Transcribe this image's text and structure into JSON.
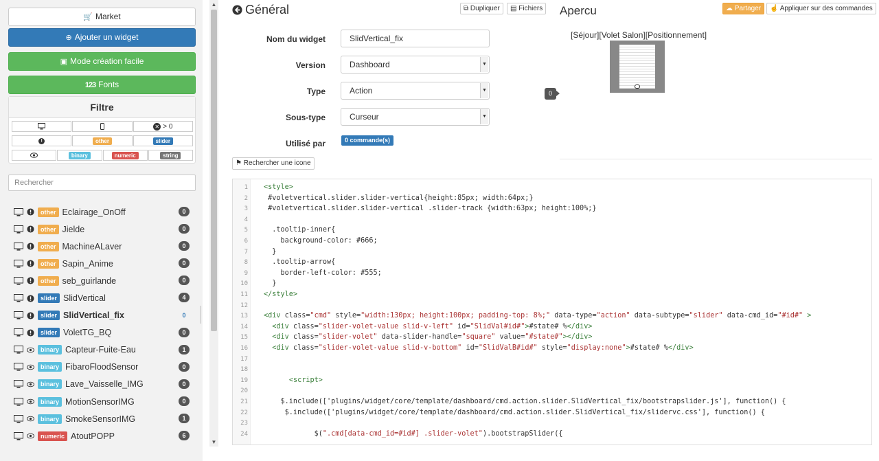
{
  "sidebar": {
    "market_label": "Market",
    "add_widget_label": "Ajouter un widget",
    "easy_mode_label": "Mode création facile",
    "fonts_label": "Fonts",
    "fonts_icon_text": "123",
    "filter_title": "Filtre",
    "filter_count_label": "> 0",
    "search_placeholder": "Rechercher",
    "filter_types": {
      "other": "other",
      "slider": "slider",
      "binary": "binary",
      "numeric": "numeric",
      "string": "string"
    },
    "widgets": [
      {
        "type": "other",
        "name": "Eclairage_OnOff",
        "count": "0",
        "eye": false
      },
      {
        "type": "other",
        "name": "Jielde",
        "count": "0",
        "eye": false
      },
      {
        "type": "other",
        "name": "MachineALaver",
        "count": "0",
        "eye": false
      },
      {
        "type": "other",
        "name": "Sapin_Anime",
        "count": "0",
        "eye": false
      },
      {
        "type": "other",
        "name": "seb_guirlande",
        "count": "0",
        "eye": false
      },
      {
        "type": "slider",
        "name": "SlidVertical",
        "count": "4",
        "eye": false
      },
      {
        "type": "slider",
        "name": "SlidVertical_fix",
        "count": "0",
        "eye": false,
        "active": true
      },
      {
        "type": "slider",
        "name": "VoletTG_BQ",
        "count": "0",
        "eye": false
      },
      {
        "type": "binary",
        "name": "Capteur-Fuite-Eau",
        "count": "1",
        "eye": true
      },
      {
        "type": "binary",
        "name": "FibaroFloodSensor",
        "count": "0",
        "eye": true
      },
      {
        "type": "binary",
        "name": "Lave_Vaisselle_IMG",
        "count": "0",
        "eye": true
      },
      {
        "type": "binary",
        "name": "MotionSensorIMG",
        "count": "0",
        "eye": true
      },
      {
        "type": "binary",
        "name": "SmokeSensorIMG",
        "count": "1",
        "eye": true
      },
      {
        "type": "numeric",
        "name": "AtoutPOPP",
        "count": "6",
        "eye": true
      }
    ]
  },
  "colors": {
    "other": "#f0ad4e",
    "slider": "#337ab7",
    "binary": "#5bc0de",
    "numeric": "#d9534f",
    "string": "#777777"
  },
  "general": {
    "title": "Général",
    "duplicate_label": "Dupliquer",
    "files_label": "Fichiers",
    "name_label": "Nom du widget",
    "name_value": "SlidVertical_fix",
    "version_label": "Version",
    "version_value": "Dashboard",
    "type_label": "Type",
    "type_value": "Action",
    "subtype_label": "Sous-type",
    "subtype_value": "Curseur",
    "used_label": "Utilisé par",
    "used_value": "0 commande(s)",
    "search_icon_label": "Rechercher une icone"
  },
  "preview": {
    "title": "Apercu",
    "share_label": "Partager",
    "apply_label": "Appliquer sur des commandes",
    "widget_label": "[Séjour][Volet Salon][Positionnement]",
    "tooltip_value": "0"
  },
  "code": [
    {
      "n": "1",
      "t": "<style>"
    },
    {
      "n": "2",
      "t": " #voletvertical.slider.slider-vertical{height:85px; width:64px;}"
    },
    {
      "n": "3",
      "t": " #voletvertical.slider.slider-vertical .slider-track {width:63px; height:100%;}"
    },
    {
      "n": "4",
      "t": ""
    },
    {
      "n": "5",
      "t": "  .tooltip-inner{"
    },
    {
      "n": "6",
      "t": "    background-color: #666;"
    },
    {
      "n": "7",
      "t": "  }"
    },
    {
      "n": "8",
      "t": "  .tooltip-arrow{"
    },
    {
      "n": "9",
      "t": "    border-left-color: #555;"
    },
    {
      "n": "10",
      "t": "  }"
    },
    {
      "n": "11",
      "t": "</style>"
    },
    {
      "n": "12",
      "t": ""
    },
    {
      "n": "13",
      "t": "<div class=\"cmd\" style=\"width:130px; height:100px; padding-top: 8%;\" data-type=\"action\" data-subtype=\"slider\" data-cmd_id=\"#id#\" >"
    },
    {
      "n": "14",
      "t": "  <div class=\"slider-volet-value slid-v-left\" id=\"SlidVal#id#\">#state# %</div>"
    },
    {
      "n": "15",
      "t": "  <div class=\"slider-volet\" data-slider-handle=\"square\" value=\"#state#\"></div>"
    },
    {
      "n": "16",
      "t": "  <div class=\"slider-volet-value slid-v-bottom\" id=\"SlidValB#id#\" style=\"display:none\">#state# %</div>"
    },
    {
      "n": "17",
      "t": ""
    },
    {
      "n": "18",
      "t": ""
    },
    {
      "n": "19",
      "t": "      <script>"
    },
    {
      "n": "20",
      "t": ""
    },
    {
      "n": "21",
      "t": "    $.include(['plugins/widget/core/template/dashboard/cmd.action.slider.SlidVertical_fix/bootstrapslider.js'], function() {"
    },
    {
      "n": "22",
      "t": "     $.include(['plugins/widget/core/template/dashboard/cmd.action.slider.SlidVertical_fix/slidervc.css'], function() {"
    },
    {
      "n": "23",
      "t": ""
    },
    {
      "n": "24",
      "t": "            $(\".cmd[data-cmd_id=#id#] .slider-volet\").bootstrapSlider({"
    }
  ]
}
